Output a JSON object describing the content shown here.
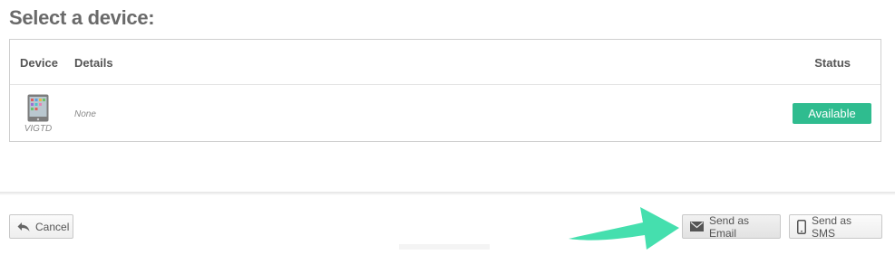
{
  "page": {
    "title": "Select a device:"
  },
  "table": {
    "columns": {
      "device": "Device",
      "details": "Details",
      "status": "Status"
    },
    "rows": [
      {
        "device_name": "VIGTD",
        "device_icon": "tablet-icon",
        "details": "None",
        "status": "Available"
      }
    ]
  },
  "footer": {
    "cancel_label": "Cancel",
    "email_label": "Send as Email",
    "sms_label": "Send as SMS"
  },
  "colors": {
    "status_available": "#2fbc8f",
    "arrow_annotation": "#45dfae"
  }
}
